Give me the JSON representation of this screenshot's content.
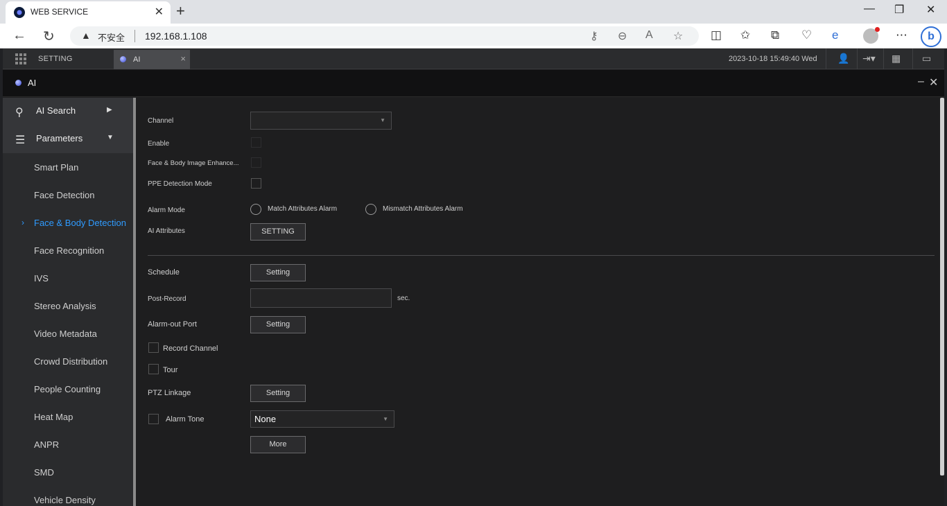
{
  "browser": {
    "tab_title": "WEB SERVICE",
    "insecure_label": "不安全",
    "url": "192.168.1.108"
  },
  "app": {
    "setting_tab": "SETTING",
    "ai_tab": "AI",
    "datetime": "2023-10-18 15:49:40 Wed",
    "window_title": "AI"
  },
  "sidebar": {
    "ai_search": "AI Search",
    "parameters": "Parameters",
    "items": [
      "Smart Plan",
      "Face Detection",
      "Face & Body Detection",
      "Face Recognition",
      "IVS",
      "Stereo Analysis",
      "Video Metadata",
      "Crowd Distribution",
      "People Counting",
      "Heat Map",
      "ANPR",
      "SMD",
      "Vehicle Density"
    ],
    "active_index": 2
  },
  "form": {
    "channel_label": "Channel",
    "channel_value": "",
    "enable_label": "Enable",
    "face_body_label": "Face & Body Image Enhance...",
    "ppe_label": "PPE Detection Mode",
    "alarm_mode_label": "Alarm Mode",
    "match_label": "Match Attributes Alarm",
    "mismatch_label": "Mismatch Attributes Alarm",
    "ai_attributes_label": "AI Attributes",
    "ai_attributes_button": "SETTING",
    "schedule_label": "Schedule",
    "schedule_button": "Setting",
    "post_record_label": "Post-Record",
    "post_record_value": "",
    "post_record_unit": "sec.",
    "alarm_out_label": "Alarm-out Port",
    "alarm_out_button": "Setting",
    "record_channel_label": "Record Channel",
    "tour_label": "Tour",
    "ptz_label": "PTZ Linkage",
    "ptz_button": "Setting",
    "alarm_tone_label": "Alarm Tone",
    "alarm_tone_value": "None",
    "more_button": "More"
  }
}
